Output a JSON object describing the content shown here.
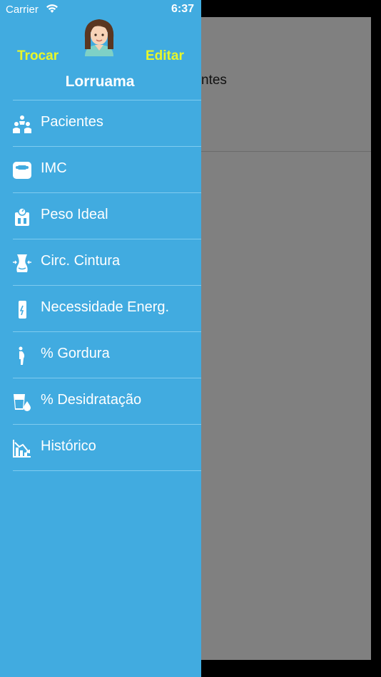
{
  "status_bar": {
    "carrier": "Carrier",
    "time": "6:37"
  },
  "background": {
    "text": "ntes"
  },
  "drawer": {
    "switch_label": "Trocar",
    "edit_label": "Editar",
    "username": "Lorruama",
    "avatar_icon": "female-avatar-icon",
    "accent_color": "#e8f72a",
    "background_color": "#41abe0",
    "items": [
      {
        "label": "Pacientes",
        "icon": "patients-icon"
      },
      {
        "label": "IMC",
        "icon": "scale-icon"
      },
      {
        "label": "Peso Ideal",
        "icon": "weight-scale-icon"
      },
      {
        "label": "Circ. Cintura",
        "icon": "waist-icon"
      },
      {
        "label": "Necessidade Energ.",
        "icon": "energy-icon"
      },
      {
        "label": "% Gordura",
        "icon": "body-fat-icon"
      },
      {
        "label": "% Desidratação",
        "icon": "hydration-icon"
      },
      {
        "label": "Histórico",
        "icon": "history-chart-icon"
      }
    ]
  }
}
